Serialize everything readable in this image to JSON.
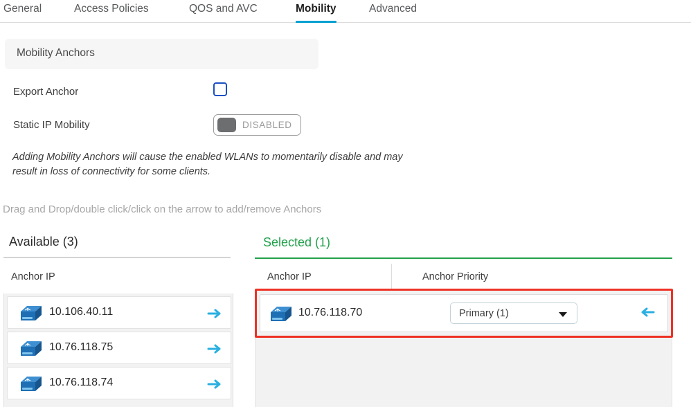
{
  "tabs": [
    {
      "label": "General",
      "active": false
    },
    {
      "label": "Access Policies",
      "active": false
    },
    {
      "label": "QOS and AVC",
      "active": false
    },
    {
      "label": "Mobility",
      "active": true
    },
    {
      "label": "Advanced",
      "active": false
    }
  ],
  "section": {
    "title": "Mobility Anchors"
  },
  "form": {
    "export_anchor_label": "Export Anchor",
    "export_anchor_checked": false,
    "static_ip_label": "Static IP Mobility",
    "static_ip_state": "DISABLED"
  },
  "warning": "Adding Mobility Anchors will cause the enabled WLANs to momentarily disable and may result in loss of connectivity for some clients.",
  "hint": "Drag and Drop/double click/click on the arrow to add/remove Anchors",
  "available": {
    "title": "Available (3)",
    "column_header": "Anchor IP",
    "rows": [
      {
        "ip": "10.106.40.11"
      },
      {
        "ip": "10.76.118.75"
      },
      {
        "ip": "10.76.118.74"
      }
    ]
  },
  "selected": {
    "title": "Selected (1)",
    "column_headers": {
      "ip": "Anchor IP",
      "priority": "Anchor Priority"
    },
    "rows": [
      {
        "ip": "10.76.118.70",
        "priority": "Primary (1)"
      }
    ]
  },
  "colors": {
    "active_tab_underline": "#00a0d1",
    "selected_green": "#21a14b",
    "highlight_red": "#ee3124",
    "arrow_cyan": "#29b0e0",
    "checkbox_blue": "#1b4fc4"
  }
}
